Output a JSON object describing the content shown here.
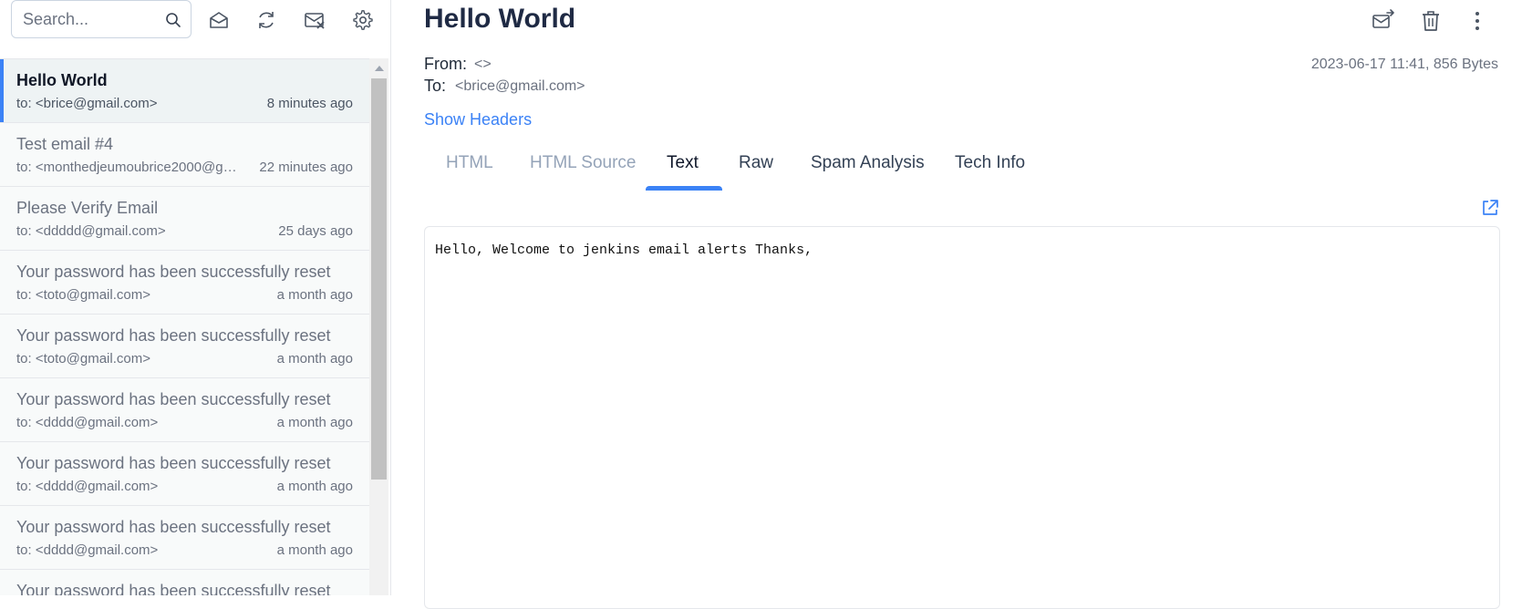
{
  "search": {
    "placeholder": "Search..."
  },
  "toolbar_icons": [
    "search-icon",
    "mark-read-icon",
    "refresh-icon",
    "delete-all-icon",
    "settings-icon"
  ],
  "emails": [
    {
      "subject": "Hello World",
      "to": "to: <brice@gmail.com>",
      "time": "8 minutes ago",
      "active": true
    },
    {
      "subject": "Test email #4",
      "to": "to: <monthedjeumoubrice2000@gmail.com>",
      "time": "22 minutes ago"
    },
    {
      "subject": "Please Verify Email",
      "to": "to: <ddddd@gmail.com>",
      "time": "25 days ago"
    },
    {
      "subject": "Your password has been successfully reset",
      "to": "to: <toto@gmail.com>",
      "time": "a month ago"
    },
    {
      "subject": "Your password has been successfully reset",
      "to": "to: <toto@gmail.com>",
      "time": "a month ago"
    },
    {
      "subject": "Your password has been successfully reset",
      "to": "to: <dddd@gmail.com>",
      "time": "a month ago"
    },
    {
      "subject": "Your password has been successfully reset",
      "to": "to: <dddd@gmail.com>",
      "time": "a month ago"
    },
    {
      "subject": "Your password has been successfully reset",
      "to": "to: <dddd@gmail.com>",
      "time": "a month ago"
    },
    {
      "subject": "Your password has been successfully reset",
      "to": "",
      "time": ""
    }
  ],
  "message": {
    "title": "Hello World",
    "from_label": "From:",
    "from_value": "<>",
    "to_label": "To:",
    "to_value": "<brice@gmail.com>",
    "date_size": "2023-06-17 11:41, 856 Bytes",
    "show_headers": "Show Headers",
    "body": "Hello, Welcome to jenkins email alerts Thanks,"
  },
  "action_icons": [
    "forward-icon",
    "trash-icon",
    "more-icon"
  ],
  "tabs": [
    {
      "label": "HTML",
      "state": "disabled"
    },
    {
      "label": "HTML Source",
      "state": "disabled"
    },
    {
      "label": "Text",
      "state": "selected"
    },
    {
      "label": "Raw",
      "state": "normal"
    },
    {
      "label": "Spam Analysis",
      "state": "normal"
    },
    {
      "label": "Tech Info",
      "state": "normal"
    }
  ],
  "colors": {
    "accent": "#3b82f6",
    "active_row": "#eef3f4",
    "list_bg": "#f8fafa"
  }
}
